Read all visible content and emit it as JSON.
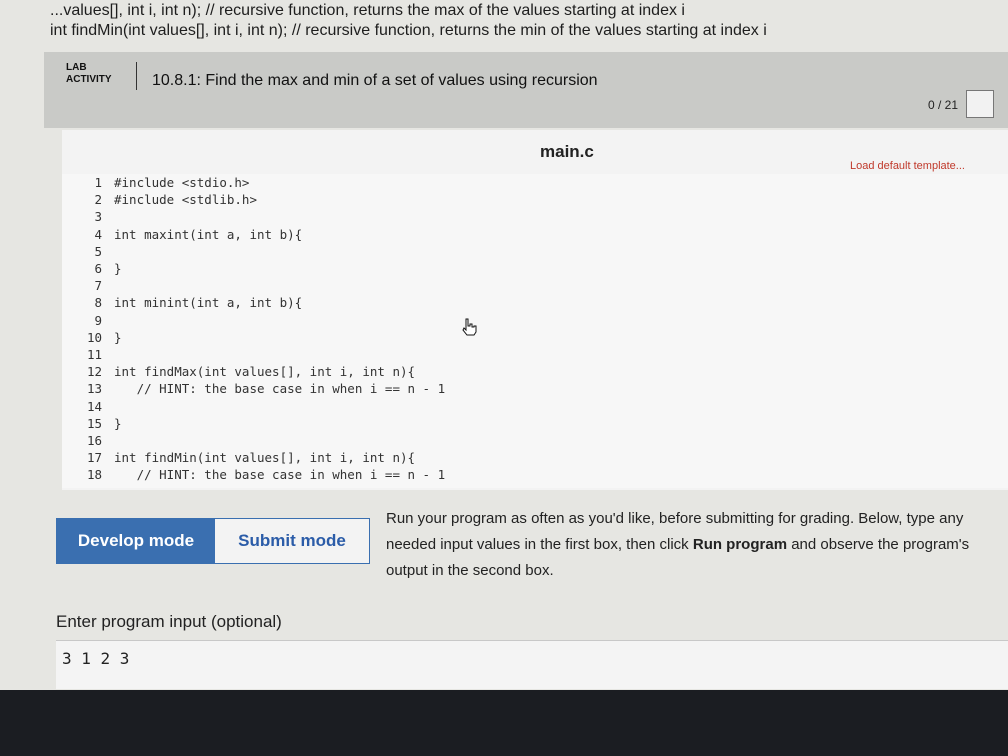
{
  "header": {
    "line1": "...values[], int i, int n); // recursive function, returns the max of the values starting at index i",
    "line2": "int findMin(int values[], int i, int n); // recursive function, returns the min of the values starting at index i"
  },
  "lab": {
    "tag_line1": "LAB",
    "tag_line2": "ACTIVITY",
    "title": "10.8.1: Find the max and min of a set of values using recursion",
    "score": "0 / 21"
  },
  "editor": {
    "file_name": "main.c",
    "load_template": "Load default template...",
    "lines": [
      {
        "n": "1",
        "text": "#include <stdio.h>"
      },
      {
        "n": "2",
        "text": "#include <stdlib.h>"
      },
      {
        "n": "3",
        "text": ""
      },
      {
        "n": "4",
        "text": "int maxint(int a, int b){"
      },
      {
        "n": "5",
        "text": ""
      },
      {
        "n": "6",
        "text": "}"
      },
      {
        "n": "7",
        "text": ""
      },
      {
        "n": "8",
        "text": "int minint(int a, int b){"
      },
      {
        "n": "9",
        "text": ""
      },
      {
        "n": "10",
        "text": "}"
      },
      {
        "n": "11",
        "text": ""
      },
      {
        "n": "12",
        "text": "int findMax(int values[], int i, int n){"
      },
      {
        "n": "13",
        "text": "   // HINT: the base case in when i == n - 1"
      },
      {
        "n": "14",
        "text": ""
      },
      {
        "n": "15",
        "text": "}"
      },
      {
        "n": "16",
        "text": ""
      },
      {
        "n": "17",
        "text": "int findMin(int values[], int i, int n){"
      },
      {
        "n": "18",
        "text": "   // HINT: the base case in when i == n - 1"
      }
    ]
  },
  "modes": {
    "develop": "Develop mode",
    "submit": "Submit mode"
  },
  "instructions": {
    "part1": "Run your program as often as you'd like, before submitting for grading. Below, type any needed input values in the first box, then click ",
    "run_program": "Run program",
    "part2": " and observe the program's output in the second box."
  },
  "input": {
    "label": "Enter program input (optional)",
    "value": "3 1 2 3"
  },
  "colors": {
    "accent": "#3a6fb0",
    "link_red": "#c0392b"
  }
}
